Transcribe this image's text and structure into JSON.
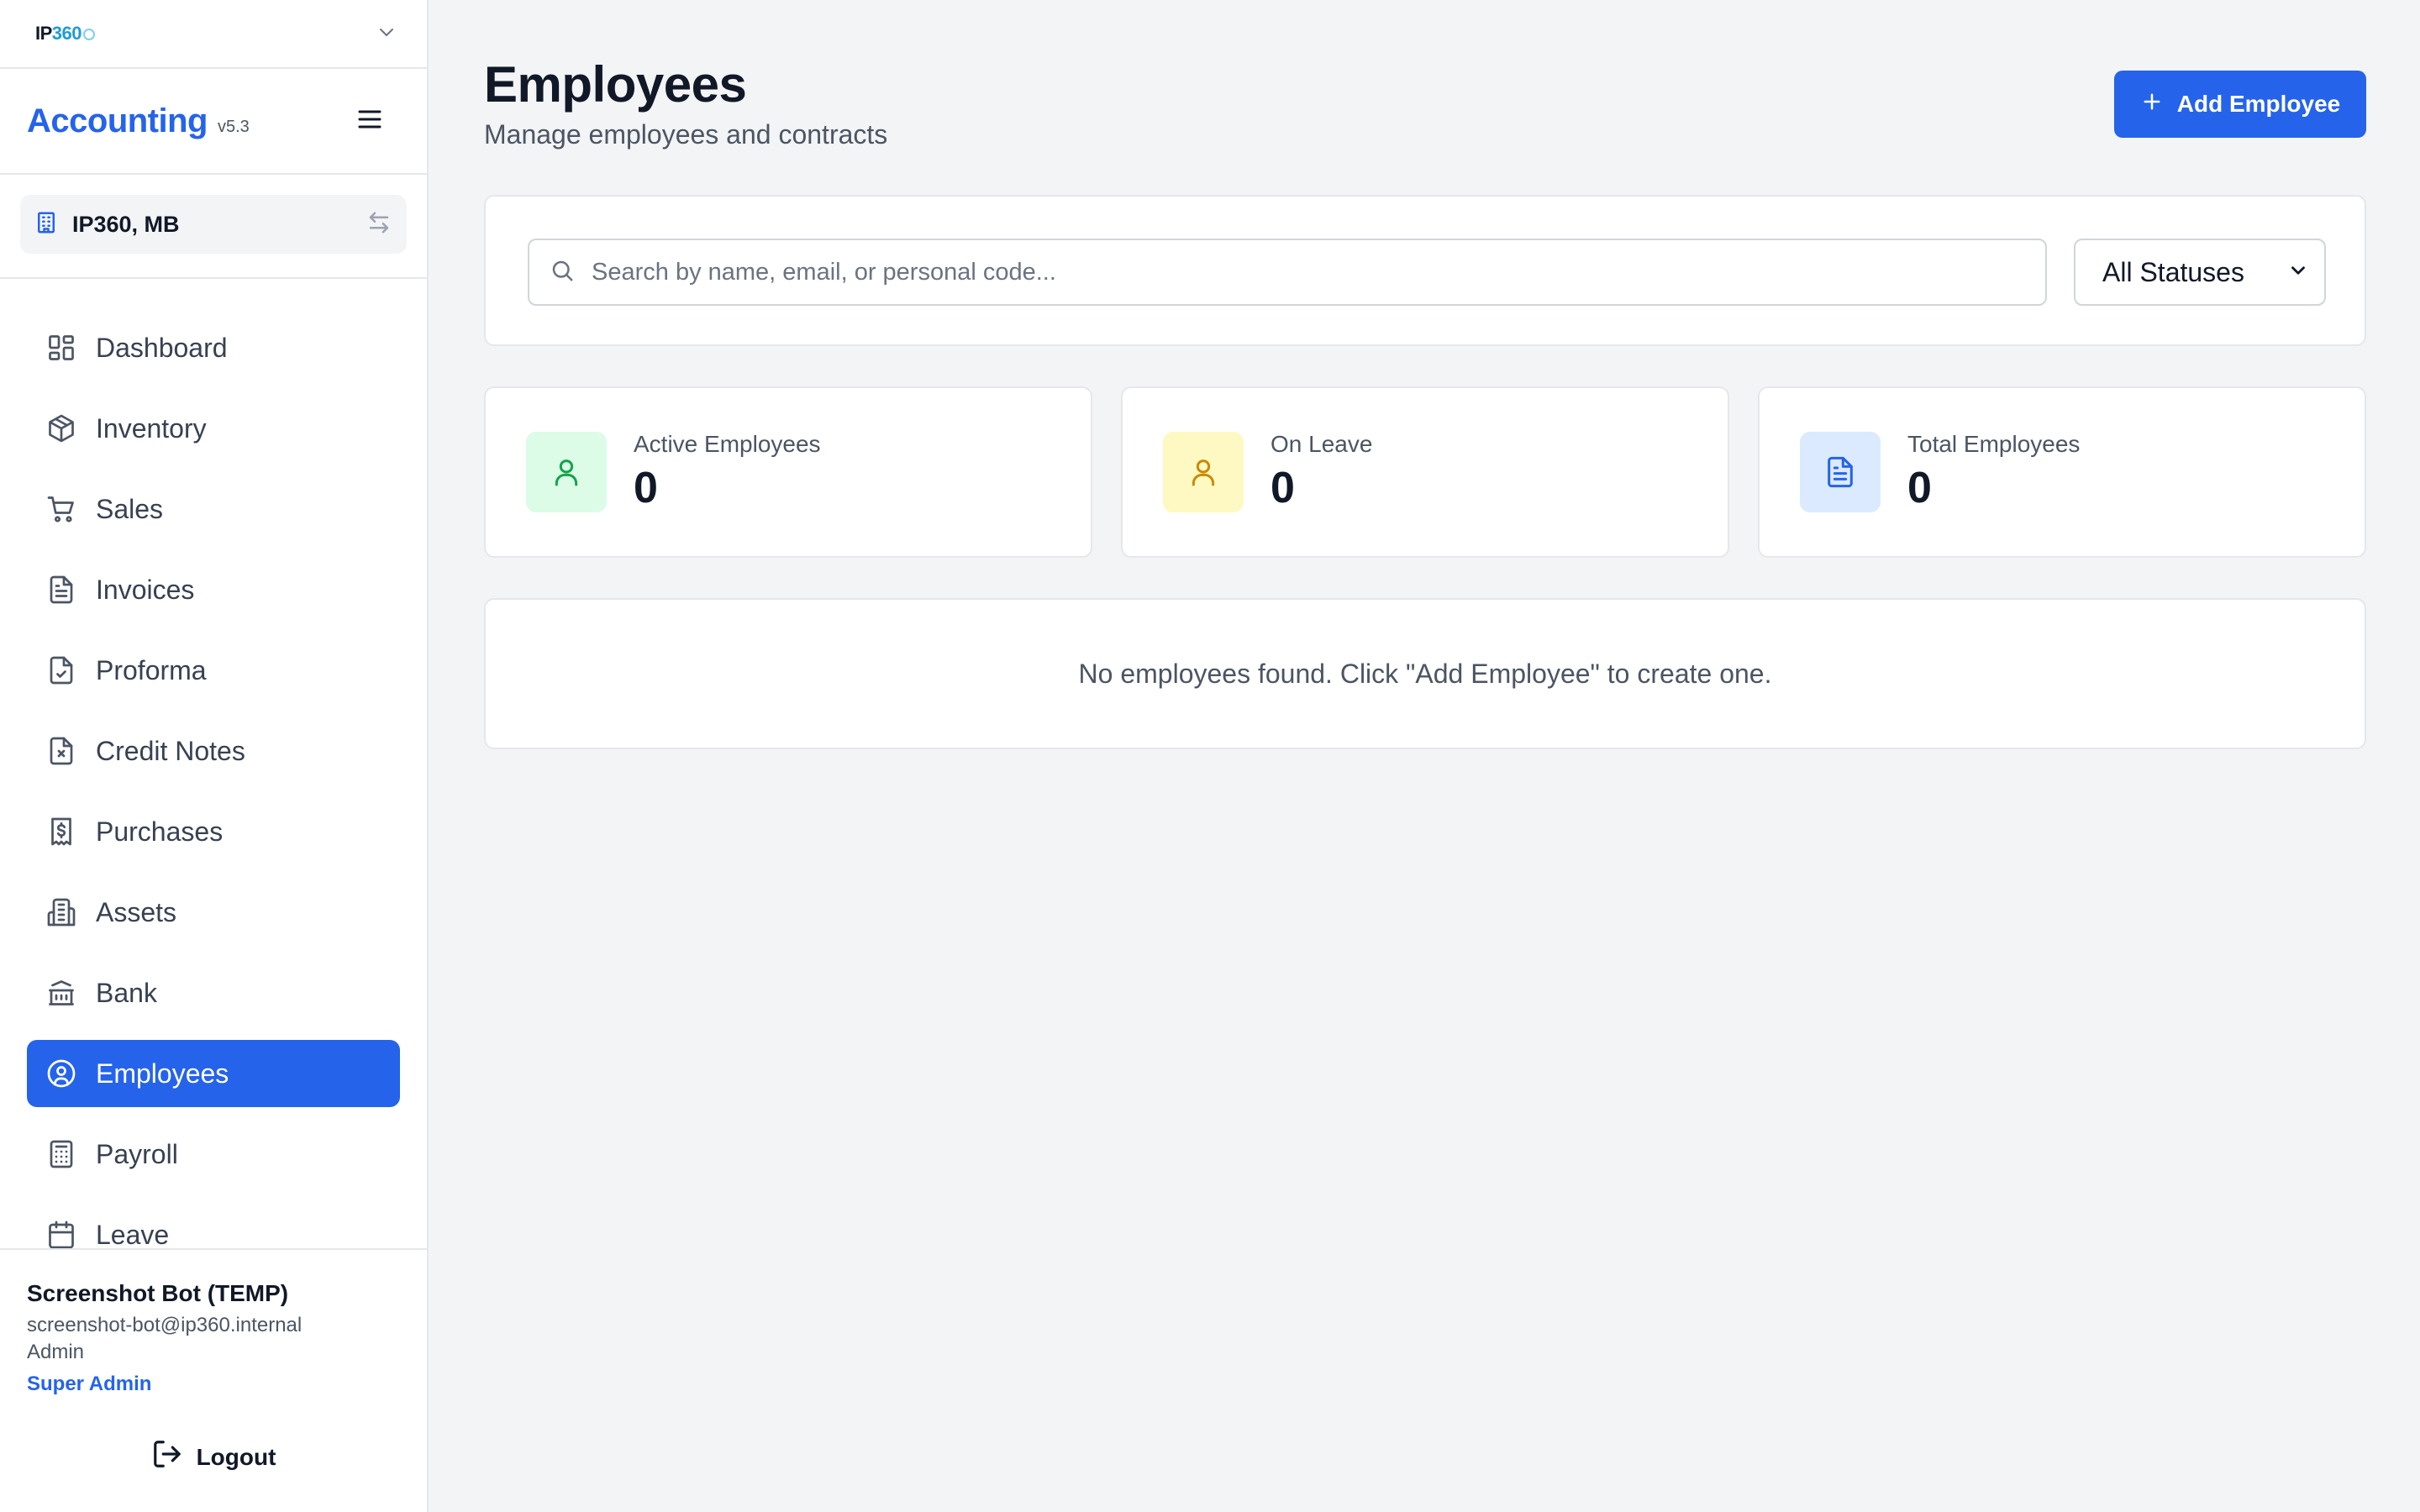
{
  "org_switcher": {
    "logo_text_a": "IP",
    "logo_text_b": "360",
    "icon": "chevron-down-icon"
  },
  "brand": {
    "name": "Accounting",
    "version": "v5.3",
    "menu_icon": "hamburger-menu-icon"
  },
  "company": {
    "name": "IP360, MB",
    "icon": "building-icon",
    "switch_icon": "swap-arrows-icon"
  },
  "nav": {
    "items": [
      {
        "label": "Dashboard",
        "icon": "dashboard-icon"
      },
      {
        "label": "Inventory",
        "icon": "package-icon"
      },
      {
        "label": "Sales",
        "icon": "cart-icon"
      },
      {
        "label": "Invoices",
        "icon": "document-icon"
      },
      {
        "label": "Proforma",
        "icon": "document-check-icon"
      },
      {
        "label": "Credit Notes",
        "icon": "document-x-icon"
      },
      {
        "label": "Purchases",
        "icon": "receipt-dollar-icon"
      },
      {
        "label": "Assets",
        "icon": "buildings-icon"
      },
      {
        "label": "Bank",
        "icon": "bank-icon"
      },
      {
        "label": "Employees",
        "icon": "user-circle-icon",
        "active": true
      },
      {
        "label": "Payroll",
        "icon": "calculator-icon"
      },
      {
        "label": "Leave",
        "icon": "calendar-icon"
      }
    ]
  },
  "user": {
    "name": "Screenshot Bot (TEMP)",
    "email": "screenshot-bot@ip360.internal",
    "role": "Admin",
    "level": "Super Admin",
    "logout_label": "Logout"
  },
  "header": {
    "title": "Employees",
    "subtitle": "Manage employees and contracts",
    "add_button_label": "Add Employee"
  },
  "filters": {
    "search_placeholder": "Search by name, email, or personal code...",
    "search_value": "",
    "status_selected": "All Statuses"
  },
  "stats": [
    {
      "label": "Active Employees",
      "value": "0",
      "icon": "user-icon",
      "color": "#16a34a",
      "bg": "#dcfce7"
    },
    {
      "label": "On Leave",
      "value": "0",
      "icon": "user-icon",
      "color": "#ca8a04",
      "bg": "#fef9c3"
    },
    {
      "label": "Total Employees",
      "value": "0",
      "icon": "document-icon",
      "color": "#2563eb",
      "bg": "#dbeafe"
    }
  ],
  "empty_message": "No employees found. Click \"Add Employee\" to create one.",
  "colors": {
    "accent": "#2563eb",
    "background": "#f3f4f6",
    "border": "#e5e7eb"
  }
}
